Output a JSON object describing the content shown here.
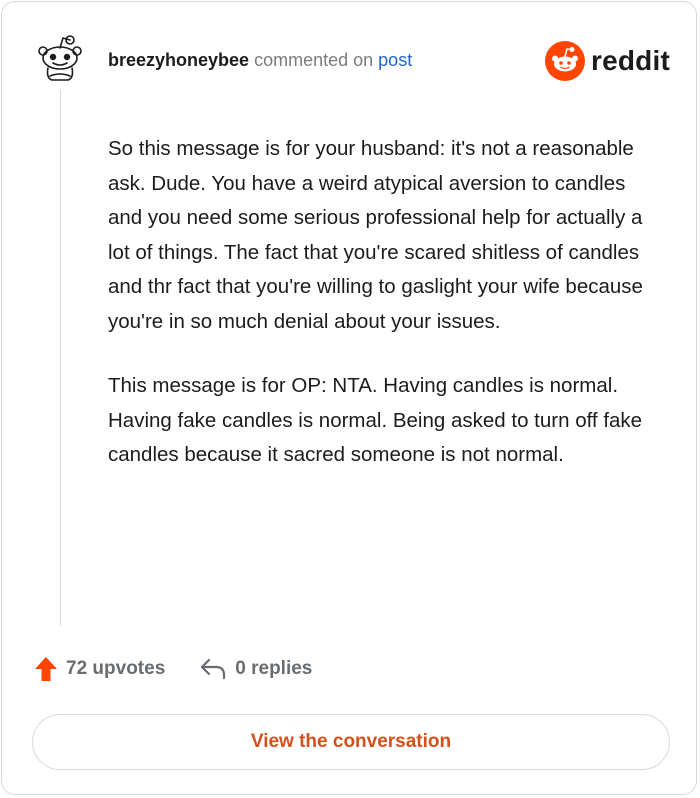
{
  "header": {
    "username": "breezyhoneybee",
    "action_text": "commented on",
    "post_link": "post"
  },
  "brand": {
    "logo_text": "reddit",
    "accent_color": "#ff4500"
  },
  "comment": {
    "paragraphs": [
      "So this message is for your husband: it's not a reasonable ask. Dude. You have a weird atypical aversion to candles and you need some serious professional help for actually a lot of things. The fact that you're scared shitless of candles and thr fact that you're willing to gaslight your wife because you're in so much denial about your issues.",
      "This message is for OP: NTA. Having candles is normal. Having fake candles is normal. Being asked to turn off fake candles because it sacred someone is not normal."
    ]
  },
  "footer": {
    "upvotes": "72 upvotes",
    "replies": "0 replies"
  },
  "cta": {
    "view_label": "View the conversation"
  },
  "icons": {
    "avatar": "snoo-avatar-icon",
    "logo": "reddit-logo-icon",
    "upvote": "upvote-arrow-icon",
    "reply": "reply-arrow-icon"
  }
}
